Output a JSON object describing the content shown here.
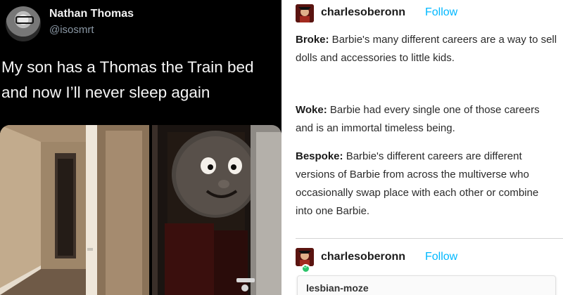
{
  "tweet": {
    "display_name": "Nathan Thomas",
    "handle": "@isosmrt",
    "text": "My son has a Thomas the Train bed and now I’ll never sleep again",
    "avatar_icon": "profile-photo",
    "images": [
      "hallway-photo",
      "dark-bedroom-thomas-photo"
    ]
  },
  "tumblr": {
    "post": {
      "username": "charlesoberonn",
      "follow_label": "Follow",
      "paragraphs": [
        {
          "label": "Broke:",
          "text": " Barbie's many different careers are a way to sell dolls and accessories to little kids."
        },
        {
          "label": "Woke:",
          "text": " Barbie had every single one of those careers and is an immortal timeless being."
        },
        {
          "label": "Bespoke:",
          "text": " Barbie's different careers are different versions of Barbie from across the multiverse who occasionally swap place with each other or combine into one Barbie."
        }
      ]
    },
    "reblog": {
      "username": "charlesoberonn",
      "follow_label": "Follow",
      "reblog_icon": "reblog-icon",
      "nested_username": "lesbian-moze"
    },
    "colors": {
      "follow": "#00b8ff",
      "reblog_badge": "#2bc46a"
    }
  }
}
